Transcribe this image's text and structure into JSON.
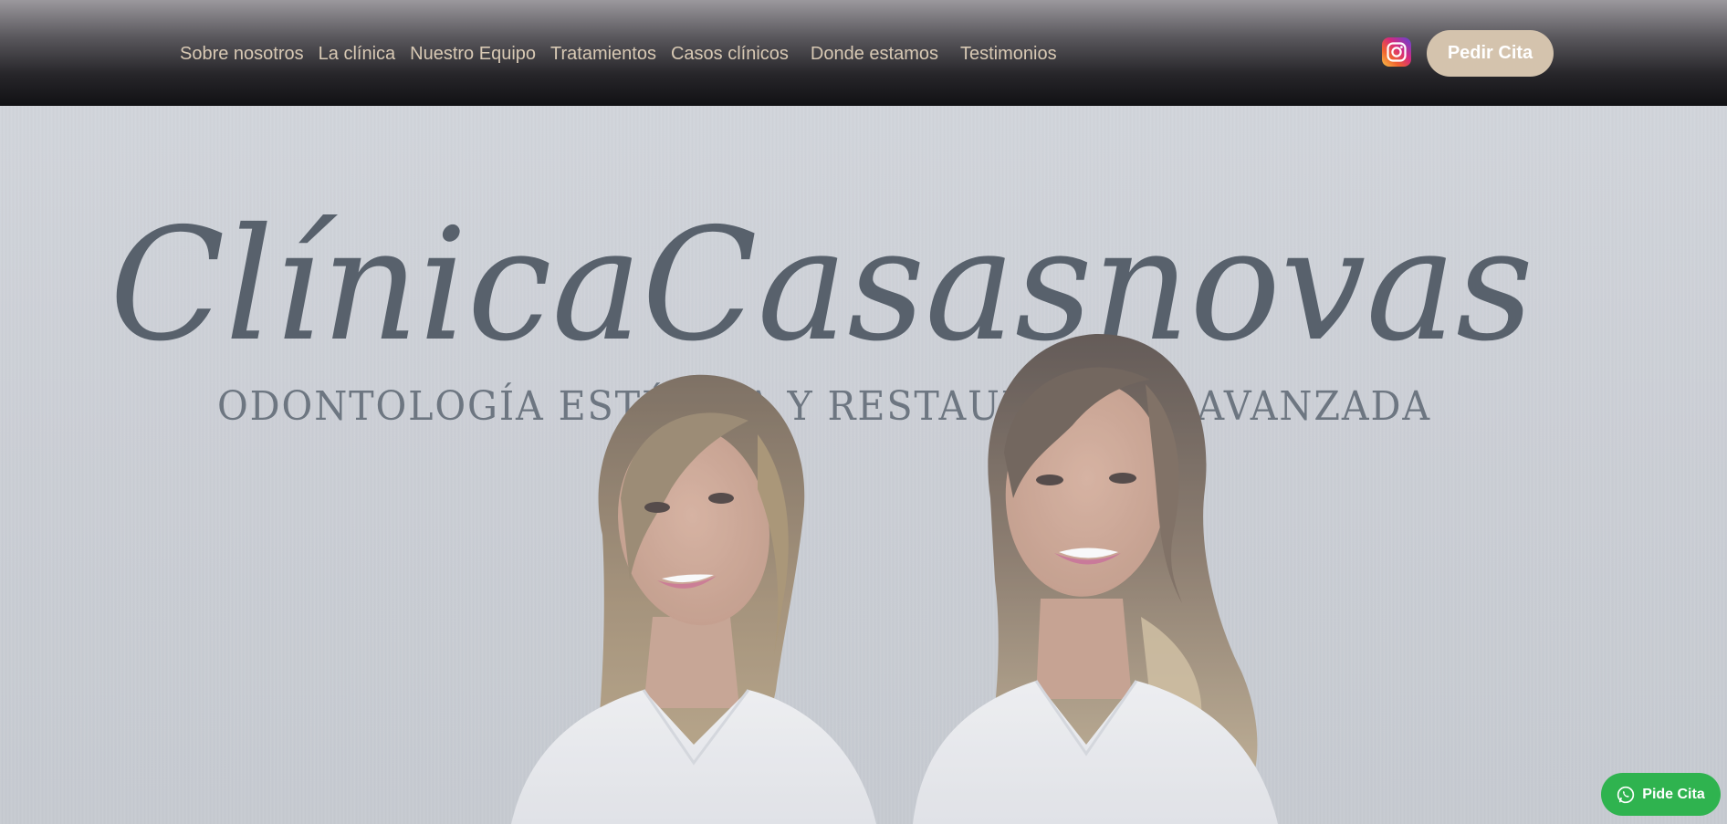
{
  "nav": {
    "items": [
      {
        "label": "Sobre nosotros"
      },
      {
        "label": "La clínica"
      },
      {
        "label": "Nuestro Equipo"
      },
      {
        "label": "Tratamientos"
      },
      {
        "label": "Casos clínicos"
      },
      {
        "label": "Donde estamos"
      },
      {
        "label": "Testimonios"
      }
    ],
    "instagram_icon": "instagram-icon",
    "cta_label": "Pedir Cita"
  },
  "hero": {
    "logo_text": "ClínicaCasasnovas",
    "tagline": "ODONTOLOGÍA ESTÉTICA Y RESTAURADORA AVANZADA",
    "photo": "two-dentists-portrait"
  },
  "whatsapp": {
    "icon": "whatsapp-icon",
    "label": "Pide Cita"
  },
  "colors": {
    "nav_text": "#d8c9b4",
    "cta_bg": "#d4c3ad",
    "whatsapp_bg": "#2fb34f",
    "logo": "#3c4652"
  }
}
